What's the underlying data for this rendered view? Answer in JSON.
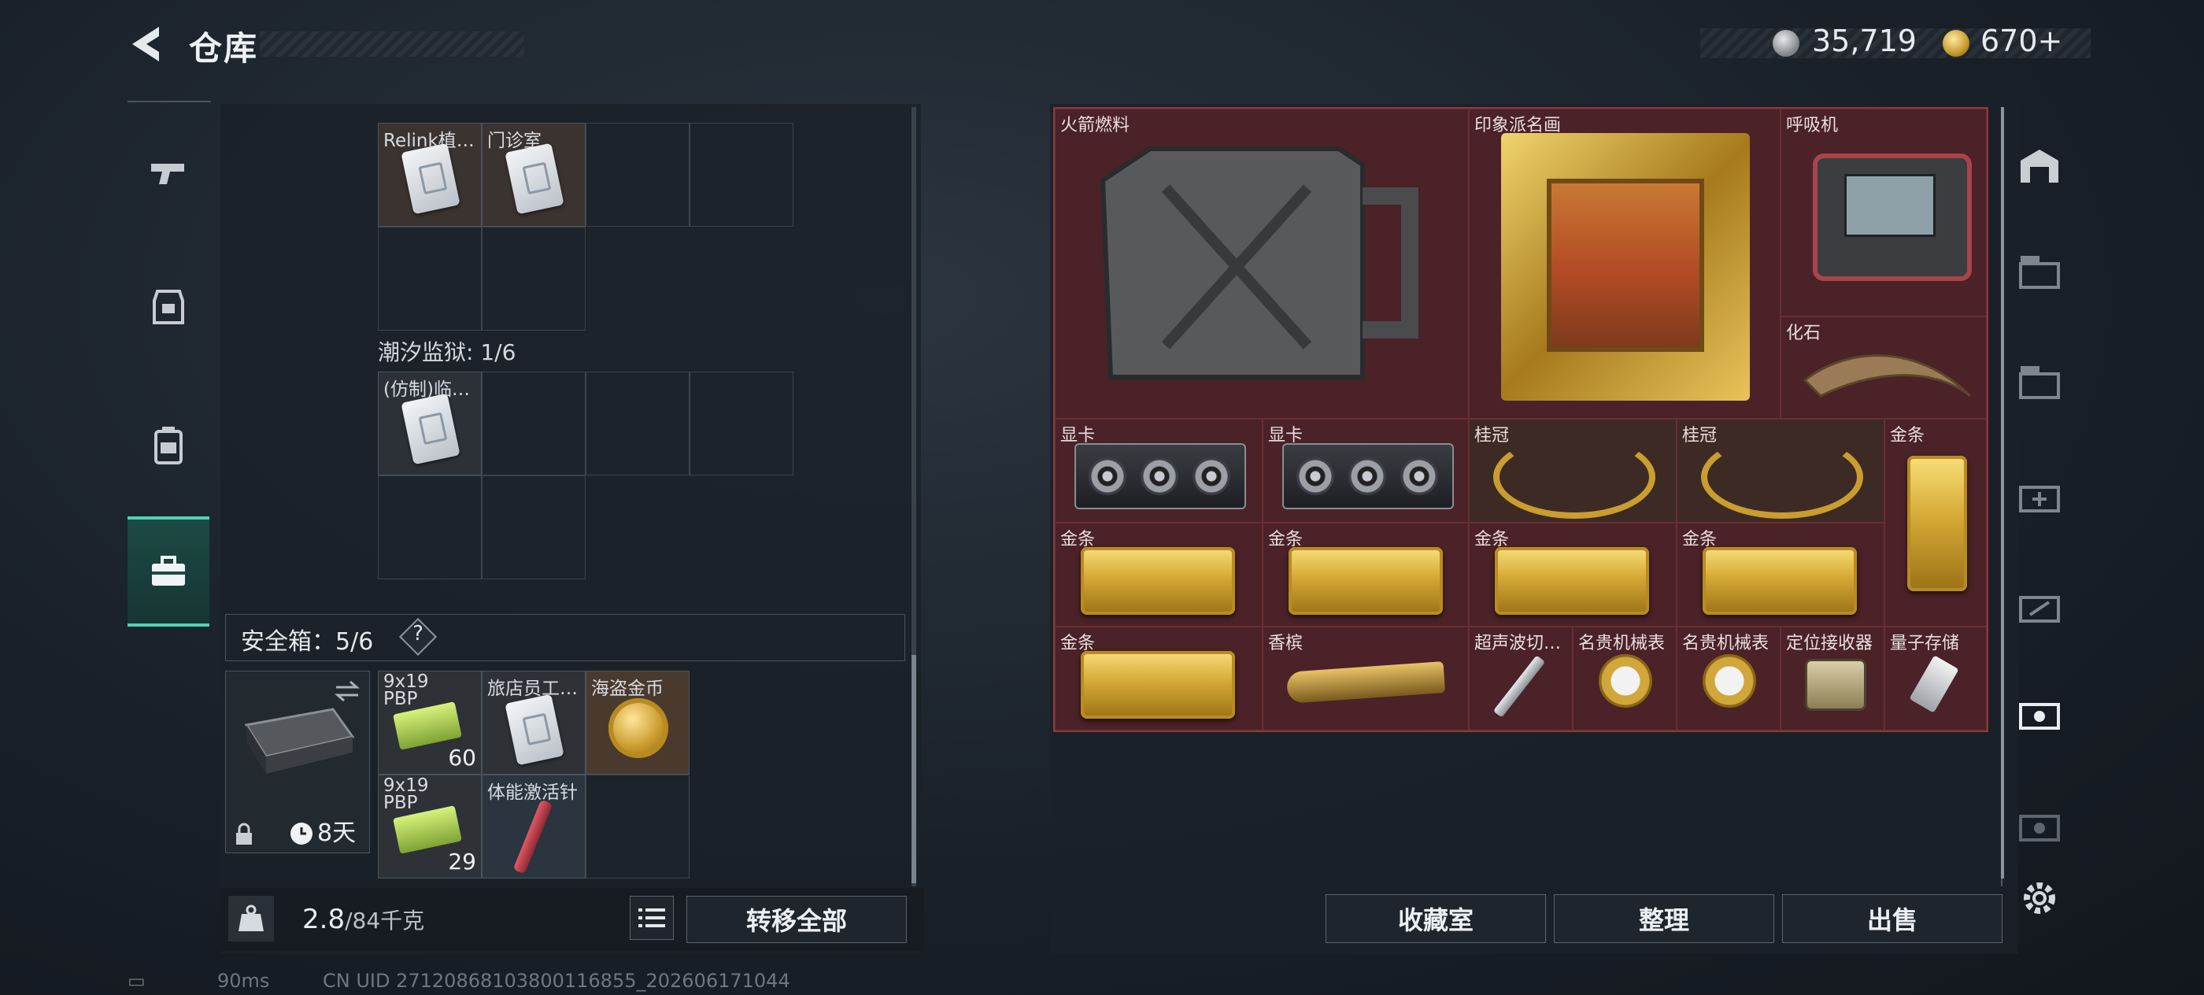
{
  "header": {
    "title": "仓库",
    "silver": "35,719",
    "gold": "670+"
  },
  "left": {
    "top_cells": [
      {
        "label": "Relink植…"
      },
      {
        "label": "门诊室"
      }
    ],
    "prison_label": "潮汐监狱: 1/6",
    "prison_item": "(仿制)临…",
    "safe_label": "安全箱：5/6",
    "help": "?",
    "case_timer": "8天",
    "safe_items": [
      {
        "label": "9x19 PBP",
        "count": "60"
      },
      {
        "label": "旅店员工…",
        "count": ""
      },
      {
        "label": "海盗金币",
        "count": ""
      },
      {
        "label": "9x19 PBP",
        "count": "29"
      },
      {
        "label": "体能激活针",
        "count": ""
      }
    ],
    "weight_value": "2.8",
    "weight_max": "/84千克",
    "transfer_all": "转移全部"
  },
  "stash": {
    "items": [
      {
        "label": "火箭燃料"
      },
      {
        "label": "印象派名画"
      },
      {
        "label": "呼吸机"
      },
      {
        "label": "化石"
      },
      {
        "label": "显卡"
      },
      {
        "label": "显卡"
      },
      {
        "label": "桂冠"
      },
      {
        "label": "桂冠"
      },
      {
        "label": "金条"
      },
      {
        "label": "金条"
      },
      {
        "label": "金条"
      },
      {
        "label": "金条"
      },
      {
        "label": "金条"
      },
      {
        "label": "金条"
      },
      {
        "label": "香槟"
      },
      {
        "label": "超声波切…"
      },
      {
        "label": "名贵机械表"
      },
      {
        "label": "名贵机械表"
      },
      {
        "label": "定位接收器"
      },
      {
        "label": "量子存储"
      }
    ],
    "buttons": {
      "collection": "收藏室",
      "sort": "整理",
      "sell": "出售"
    }
  },
  "status": {
    "ping": "90ms",
    "uid": "CN UID 27120868103800116855_202606171044"
  },
  "colors": {
    "accent": "#4fd3b1",
    "stash_bg": "#4a2227",
    "gold": "#d5a936"
  }
}
